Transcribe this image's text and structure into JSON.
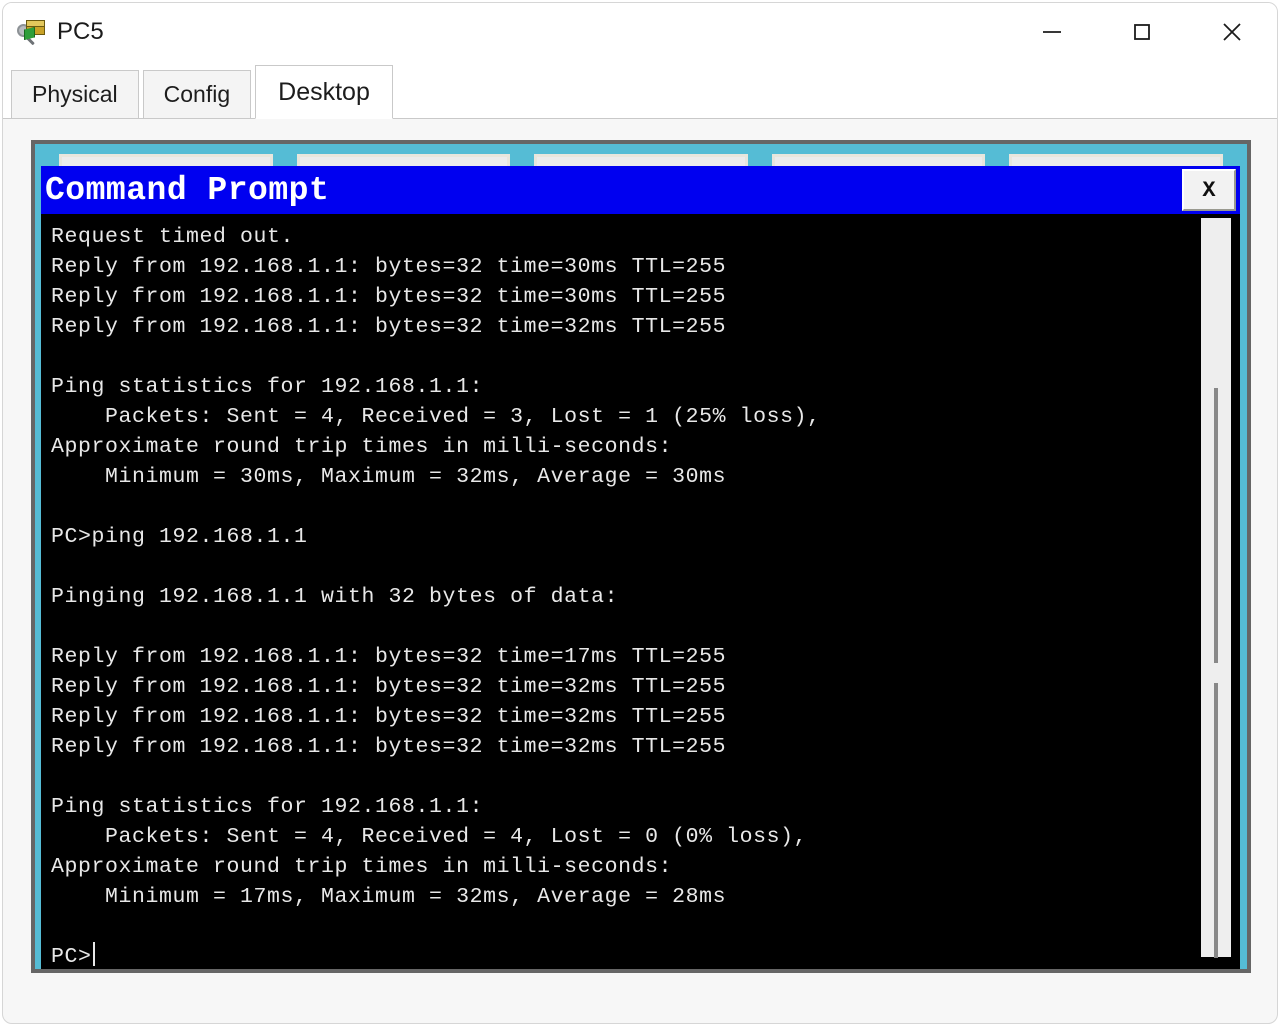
{
  "window": {
    "title": "PC5",
    "icon": "packet-tracer-pc-icon",
    "controls": {
      "minimize": "minimize",
      "maximize": "maximize",
      "close": "close"
    }
  },
  "tabs": [
    {
      "label": "Physical",
      "active": false
    },
    {
      "label": "Config",
      "active": false
    },
    {
      "label": "Desktop",
      "active": true
    }
  ],
  "desktop": {
    "background_color": "#55bcd5",
    "tiles": [
      {
        "name": "app-tile-1"
      },
      {
        "name": "app-tile-2"
      },
      {
        "name": "app-tile-3"
      },
      {
        "name": "app-tile-4"
      },
      {
        "name": "app-tile-5"
      }
    ]
  },
  "command_prompt": {
    "title": "Command Prompt",
    "title_bar_color": "#0000f0",
    "close_label": "X",
    "background_color": "#000000",
    "text_color": "#e8e8e8",
    "lines": [
      "Request timed out.",
      "Reply from 192.168.1.1: bytes=32 time=30ms TTL=255",
      "Reply from 192.168.1.1: bytes=32 time=30ms TTL=255",
      "Reply from 192.168.1.1: bytes=32 time=32ms TTL=255",
      "",
      "Ping statistics for 192.168.1.1:",
      "    Packets: Sent = 4, Received = 3, Lost = 1 (25% loss),",
      "Approximate round trip times in milli-seconds:",
      "    Minimum = 30ms, Maximum = 32ms, Average = 30ms",
      "",
      "PC>ping 192.168.1.1",
      "",
      "Pinging 192.168.1.1 with 32 bytes of data:",
      "",
      "Reply from 192.168.1.1: bytes=32 time=17ms TTL=255",
      "Reply from 192.168.1.1: bytes=32 time=32ms TTL=255",
      "Reply from 192.168.1.1: bytes=32 time=32ms TTL=255",
      "Reply from 192.168.1.1: bytes=32 time=32ms TTL=255",
      "",
      "Ping statistics for 192.168.1.1:",
      "    Packets: Sent = 4, Received = 4, Lost = 0 (0% loss),",
      "Approximate round trip times in milli-seconds:",
      "    Minimum = 17ms, Maximum = 32ms, Average = 28ms",
      ""
    ],
    "prompt": "PC>",
    "scrollbar": {
      "present": true
    }
  }
}
